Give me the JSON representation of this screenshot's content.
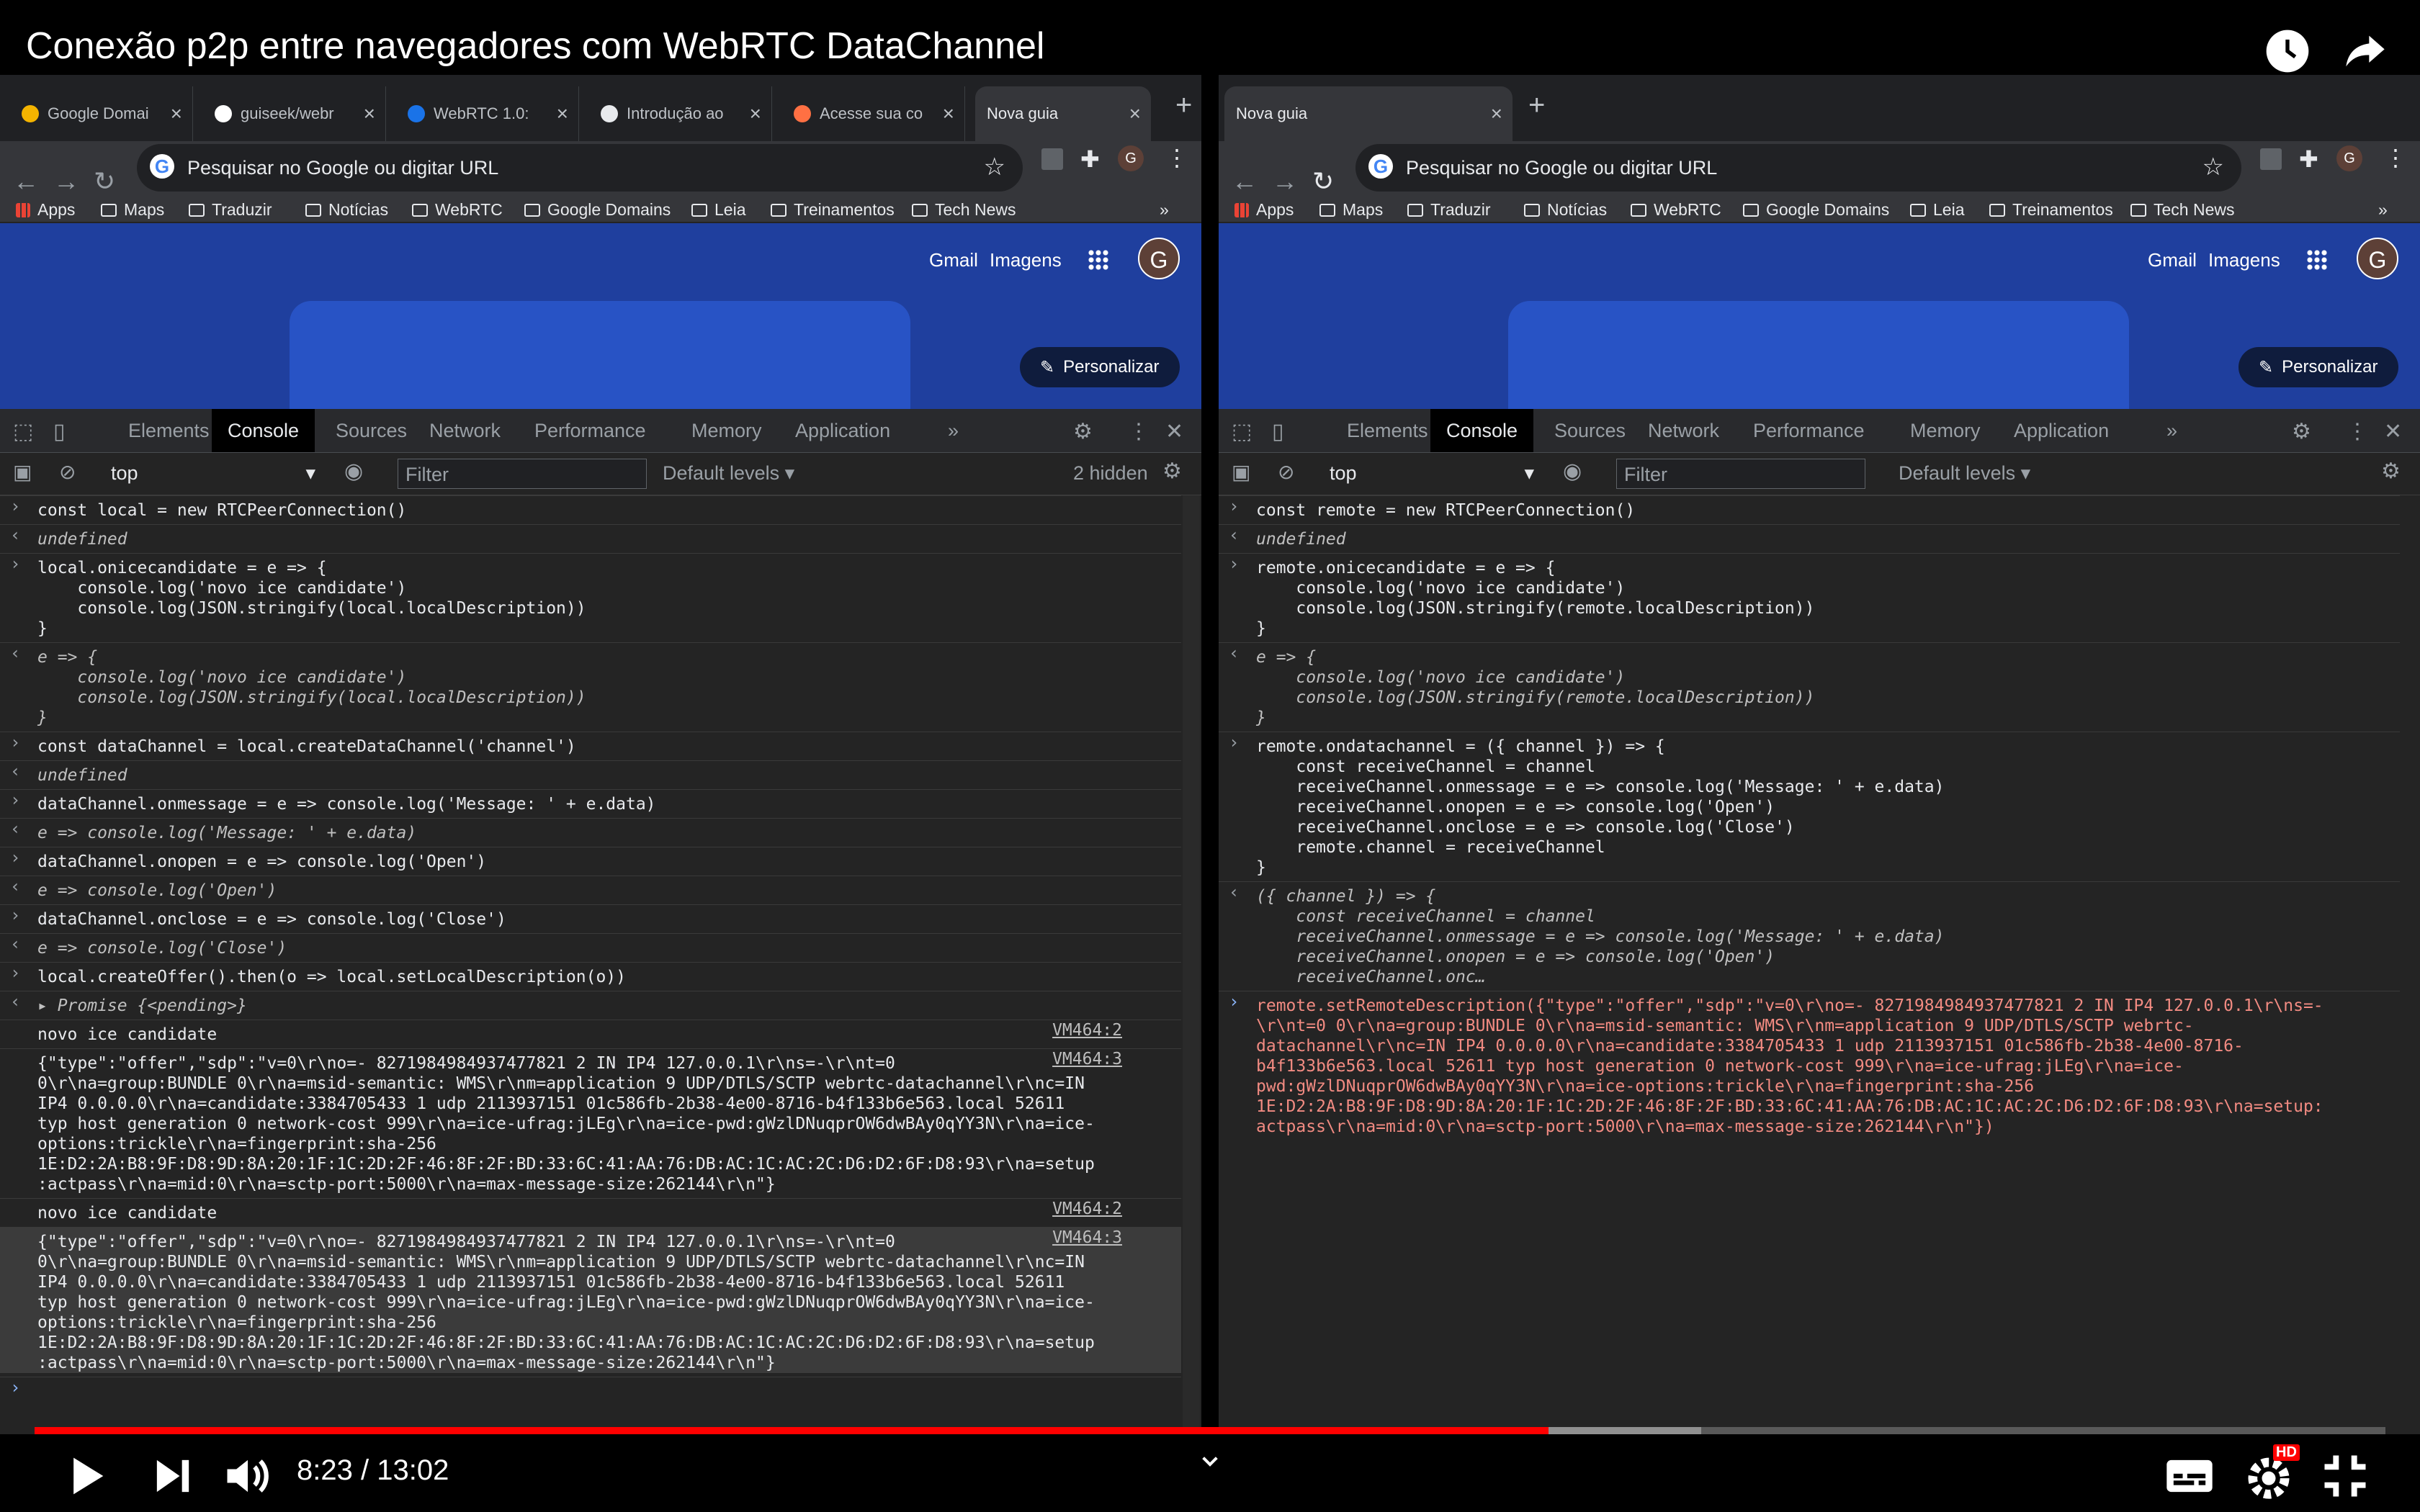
{
  "video": {
    "title": "Conexão p2p entre navegadores com WebRTC DataChannel",
    "time_current": "8:23",
    "time_separator": "/",
    "time_total": "13:02",
    "progress_played": 0.644,
    "progress_buffered": 0.709,
    "quality_badge": "HD",
    "icons": [
      "watch-later-icon",
      "share-icon",
      "play-icon",
      "next-icon",
      "volume-icon",
      "chevron-down-icon",
      "subtitles-icon",
      "settings-icon",
      "exit-fullscreen-icon"
    ]
  },
  "left": {
    "tabs": [
      {
        "label": "Google Domai",
        "fav": "#f4b400"
      },
      {
        "label": "guiseek/webr",
        "fav": "#ffffff"
      },
      {
        "label": "WebRTC 1.0:",
        "fav": "#1a73e8"
      },
      {
        "label": "Introdução ao",
        "fav": "#e8eaed"
      },
      {
        "label": "Acesse sua co",
        "fav": "#ff7043"
      },
      {
        "label": "Nova guia",
        "fav": null
      }
    ],
    "hidden_count": "2 hidden",
    "console": [
      {
        "type": "in",
        "text": "const local = new RTCPeerConnection()"
      },
      {
        "type": "res",
        "text": "undefined"
      },
      {
        "type": "in",
        "text": "local.onicecandidate = e => {\n    console.log('novo ice candidate')\n    console.log(JSON.stringify(local.localDescription))\n}"
      },
      {
        "type": "res",
        "text": "e => {\n    console.log('novo ice candidate')\n    console.log(JSON.stringify(local.localDescription))\n}"
      },
      {
        "type": "in",
        "text": "const dataChannel = local.createDataChannel('channel')"
      },
      {
        "type": "res",
        "text": "undefined"
      },
      {
        "type": "in",
        "text": "dataChannel.onmessage = e => console.log('Message: ' + e.data)"
      },
      {
        "type": "res",
        "text": "e => console.log('Message: ' + e.data)"
      },
      {
        "type": "in",
        "text": "dataChannel.onopen = e => console.log('Open')"
      },
      {
        "type": "res",
        "text": "e => console.log('Open')"
      },
      {
        "type": "in",
        "text": "dataChannel.onclose = e => console.log('Close')"
      },
      {
        "type": "res",
        "text": "e => console.log('Close')"
      },
      {
        "type": "in",
        "text": "local.createOffer().then(o => local.setLocalDescription(o))"
      },
      {
        "type": "res",
        "text": "▸ Promise {<pending>}"
      },
      {
        "type": "out",
        "text": "novo ice candidate",
        "src": "VM464:2"
      },
      {
        "type": "out",
        "text": "{\"type\":\"offer\",\"sdp\":\"v=0\\r\\no=- 8271984984937477821 2 IN IP4 127.0.0.1\\r\\ns=-\\r\\nt=0\n0\\r\\na=group:BUNDLE 0\\r\\na=msid-semantic: WMS\\r\\nm=application 9 UDP/DTLS/SCTP webrtc-datachannel\\r\\nc=IN\nIP4 0.0.0.0\\r\\na=candidate:3384705433 1 udp 2113937151 01c586fb-2b38-4e00-8716-b4f133b6e563.local 52611\ntyp host generation 0 network-cost 999\\r\\na=ice-ufrag:jLEg\\r\\na=ice-pwd:gWzlDNuqprOW6dwBAy0qYY3N\\r\\na=ice-\noptions:trickle\\r\\na=fingerprint:sha-256\n1E:D2:2A:B8:9F:D8:9D:8A:20:1F:1C:2D:2F:46:8F:2F:BD:33:6C:41:AA:76:DB:AC:1C:AC:2C:D6:D2:6F:D8:93\\r\\na=setup\n:actpass\\r\\na=mid:0\\r\\na=sctp-port:5000\\r\\na=max-message-size:262144\\r\\n\"}",
        "src": "VM464:3"
      },
      {
        "type": "out",
        "text": "novo ice candidate",
        "src": "VM464:2"
      },
      {
        "type": "sel",
        "text": "{\"type\":\"offer\",\"sdp\":\"v=0\\r\\no=- 8271984984937477821 2 IN IP4 127.0.0.1\\r\\ns=-\\r\\nt=0\n0\\r\\na=group:BUNDLE 0\\r\\na=msid-semantic: WMS\\r\\nm=application 9 UDP/DTLS/SCTP webrtc-datachannel\\r\\nc=IN\nIP4 0.0.0.0\\r\\na=candidate:3384705433 1 udp 2113937151 01c586fb-2b38-4e00-8716-b4f133b6e563.local 52611\ntyp host generation 0 network-cost 999\\r\\na=ice-ufrag:jLEg\\r\\na=ice-pwd:gWzlDNuqprOW6dwBAy0qYY3N\\r\\na=ice-\noptions:trickle\\r\\na=fingerprint:sha-256\n1E:D2:2A:B8:9F:D8:9D:8A:20:1F:1C:2D:2F:46:8F:2F:BD:33:6C:41:AA:76:DB:AC:1C:AC:2C:D6:D2:6F:D8:93\\r\\na=setup\n:actpass\\r\\na=mid:0\\r\\na=sctp-port:5000\\r\\na=max-message-size:262144\\r\\n\"}",
        "src": "VM464:3"
      },
      {
        "type": "prompt",
        "text": ""
      }
    ]
  },
  "right": {
    "tabs": [
      {
        "label": "Nova guia",
        "fav": null
      }
    ],
    "console": [
      {
        "type": "in",
        "text": "const remote = new RTCPeerConnection()"
      },
      {
        "type": "res",
        "text": "undefined"
      },
      {
        "type": "in",
        "text": "remote.onicecandidate = e => {\n    console.log('novo ice candidate')\n    console.log(JSON.stringify(remote.localDescription))\n}"
      },
      {
        "type": "res",
        "text": "e => {\n    console.log('novo ice candidate')\n    console.log(JSON.stringify(remote.localDescription))\n}"
      },
      {
        "type": "in",
        "text": "remote.ondatachannel = ({ channel }) => {\n    const receiveChannel = channel\n    receiveChannel.onmessage = e => console.log('Message: ' + e.data)\n    receiveChannel.onopen = e => console.log('Open')\n    receiveChannel.onclose = e => console.log('Close')\n    remote.channel = receiveChannel\n}"
      },
      {
        "type": "res",
        "text": "({ channel }) => {\n    const receiveChannel = channel\n    receiveChannel.onmessage = e => console.log('Message: ' + e.data)\n    receiveChannel.onopen = e => console.log('Open')\n    receiveChannel.onc…"
      },
      {
        "type": "err",
        "text": "remote.setRemoteDescription({\"type\":\"offer\",\"sdp\":\"v=0\\r\\no=- 8271984984937477821 2 IN IP4 127.0.0.1\\r\\ns=-\n\\r\\nt=0 0\\r\\na=group:BUNDLE 0\\r\\na=msid-semantic: WMS\\r\\nm=application 9 UDP/DTLS/SCTP webrtc-\ndatachannel\\r\\nc=IN IP4 0.0.0.0\\r\\na=candidate:3384705433 1 udp 2113937151 01c586fb-2b38-4e00-8716-\nb4f133b6e563.local 52611 typ host generation 0 network-cost 999\\r\\na=ice-ufrag:jLEg\\r\\na=ice-\npwd:gWzlDNuqprOW6dwBAy0qYY3N\\r\\na=ice-options:trickle\\r\\na=fingerprint:sha-256\n1E:D2:2A:B8:9F:D8:9D:8A:20:1F:1C:2D:2F:46:8F:2F:BD:33:6C:41:AA:76:DB:AC:1C:AC:2C:D6:D2:6F:D8:93\\r\\na=setup:\nactpass\\r\\na=mid:0\\r\\na=sctp-port:5000\\r\\na=max-message-size:262144\\r\\n\"})"
      }
    ]
  },
  "browser": {
    "new_tab_symbol": "+",
    "omnibox_placeholder": "Pesquisar no Google ou digitar URL",
    "bookmarks": [
      "Apps",
      "Maps",
      "Traduzir",
      "Notícias",
      "WebRTC",
      "Google Domains",
      "Leia",
      "Treinamentos",
      "Tech News"
    ],
    "bookmarks_overflow": "»",
    "page_links": {
      "gmail": "Gmail",
      "imagens": "Imagens"
    },
    "avatar_letter": "G",
    "personalizar": "Personalizar"
  },
  "devtools": {
    "tabs": [
      "Elements",
      "Console",
      "Sources",
      "Network",
      "Performance",
      "Memory",
      "Application"
    ],
    "more": "»",
    "active_tab": "Console",
    "context": "top",
    "filter_placeholder": "Filter",
    "levels": "Default levels ▾"
  },
  "colors": {
    "accent_red": "#ff0000",
    "page_blue": "#1f3f9e",
    "devtools_bg": "#242424",
    "error_text": "#f28b82"
  }
}
